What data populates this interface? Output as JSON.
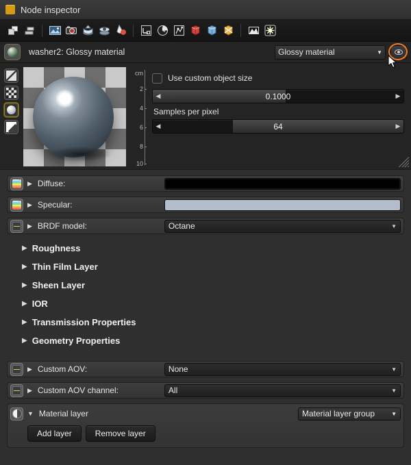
{
  "window": {
    "title": "Node inspector",
    "chip_color": "#d79a15"
  },
  "toolbar": {
    "items": [
      {
        "name": "duplicate-nodes-icon",
        "label": "Duplicate"
      },
      {
        "name": "align-nodes-icon",
        "label": "Align"
      },
      {
        "sep": true
      },
      {
        "name": "image-icon",
        "label": "Image"
      },
      {
        "name": "camera-icon",
        "label": "Camera"
      },
      {
        "name": "save-render-icon",
        "label": "Save render"
      },
      {
        "name": "load-render-icon",
        "label": "Load render"
      },
      {
        "name": "color-drop-icon",
        "label": "Color"
      },
      {
        "sep": true
      },
      {
        "name": "transform-icon",
        "label": "Transform"
      },
      {
        "name": "clock-icon",
        "label": "Time"
      },
      {
        "name": "network-icon",
        "label": "Network"
      },
      {
        "name": "red-cube-icon",
        "label": "Red cube"
      },
      {
        "name": "blue-cube-icon",
        "label": "Blue cube"
      },
      {
        "name": "orange-cube-icon",
        "label": "Orange cube"
      },
      {
        "sep": true
      },
      {
        "name": "histogram-icon",
        "label": "Histogram"
      },
      {
        "name": "light-icon",
        "label": "Light"
      }
    ]
  },
  "node_header": {
    "icon": "material-sphere-icon",
    "name": "washer2:  Glossy material",
    "type_select": "Glossy material",
    "eye_button": "visibility-eye-icon"
  },
  "preview": {
    "modes": [
      {
        "name": "mode-none-icon",
        "selected": false
      },
      {
        "name": "mode-checker-icon",
        "selected": false
      },
      {
        "name": "mode-sphere-icon",
        "selected": true
      },
      {
        "name": "mode-plane-icon",
        "selected": false
      }
    ],
    "ruler": {
      "unit": "cm",
      "ticks": [
        "2",
        "4",
        "6",
        "8",
        "10"
      ]
    },
    "custom_size": {
      "checkbox_label": "Use custom object size",
      "checked": false,
      "value": "0.1000",
      "fill_percent": 53
    },
    "samples": {
      "label": "Samples per pixel",
      "value": "64",
      "fill_percent": 32
    }
  },
  "properties": [
    {
      "name": "diffuse",
      "icon": "color-gradient-icon",
      "label": "Diffuse:",
      "control": "color",
      "color": "#000000"
    },
    {
      "name": "specular",
      "icon": "color-gradient-icon",
      "label": "Specular:",
      "control": "color",
      "color": "#b4bdcb"
    },
    {
      "name": "brdf-model",
      "icon": "list-icon",
      "label": "BRDF model:",
      "control": "combo",
      "value": "Octane"
    }
  ],
  "sections": [
    {
      "name": "roughness",
      "label": "Roughness",
      "expanded": false
    },
    {
      "name": "thin-film-layer",
      "label": "Thin Film Layer",
      "expanded": false
    },
    {
      "name": "sheen-layer",
      "label": "Sheen Layer",
      "expanded": false
    },
    {
      "name": "ior",
      "label": "IOR",
      "expanded": false
    },
    {
      "name": "transmission-properties",
      "label": "Transmission Properties",
      "expanded": false
    },
    {
      "name": "geometry-properties",
      "label": "Geometry Properties",
      "expanded": false
    }
  ],
  "aov": [
    {
      "name": "custom-aov",
      "icon": "list-icon",
      "label": "Custom AOV:",
      "value": "None"
    },
    {
      "name": "custom-aov-channel",
      "icon": "list-icon",
      "label": "Custom AOV channel:",
      "value": "All"
    }
  ],
  "material_layer": {
    "icon": "material-layer-icon",
    "label": "Material layer",
    "expanded": true,
    "group_select": "Material layer group",
    "add_button": "Add layer",
    "remove_button": "Remove layer"
  },
  "glyphs": {
    "collapsed": "▶",
    "expanded": "▼",
    "caret_down": "▼",
    "arrow_left": "◀",
    "arrow_right": "▶"
  }
}
